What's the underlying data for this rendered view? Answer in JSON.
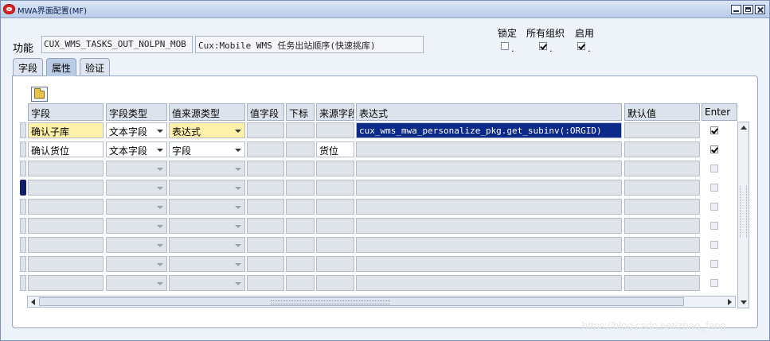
{
  "window": {
    "title": "MWA界面配置(MF)"
  },
  "header": {
    "function_label": "功能",
    "function_code": "CUX_WMS_TASKS_OUT_NOLPN_MOB",
    "function_desc": "Cux:Mobile WMS 任务出站顺序(快速挑库)",
    "flags": [
      {
        "label": "锁定",
        "checked": false
      },
      {
        "label": "所有组织",
        "checked": true
      },
      {
        "label": "启用",
        "checked": true
      }
    ]
  },
  "tabs": [
    {
      "label": "字段",
      "active": false
    },
    {
      "label": "属性",
      "active": true
    },
    {
      "label": "验证",
      "active": false
    }
  ],
  "table": {
    "columns": {
      "field": "字段",
      "field_type": "字段类型",
      "value_source_type": "值来源类型",
      "value_field": "值字段",
      "subscript": "下标",
      "source_field": "来源字段",
      "expression": "表达式",
      "default_value": "默认值",
      "enter": "Enter"
    },
    "rows": [
      {
        "field": "确认子库",
        "field_type": "文本字段",
        "value_source_type": "表达式",
        "value_field": "",
        "subscript": "",
        "source_field": "",
        "expression": "cux_wms_mwa_personalize_pkg.get_subinv(:ORGID)",
        "default_value": "",
        "enter": true
      },
      {
        "field": "确认货位",
        "field_type": "文本字段",
        "value_source_type": "字段",
        "value_field": "",
        "subscript": "",
        "source_field": "货位",
        "expression": "",
        "default_value": "",
        "enter": true
      }
    ]
  },
  "watermark": "https://blog.csdn.net/zhao_fang"
}
